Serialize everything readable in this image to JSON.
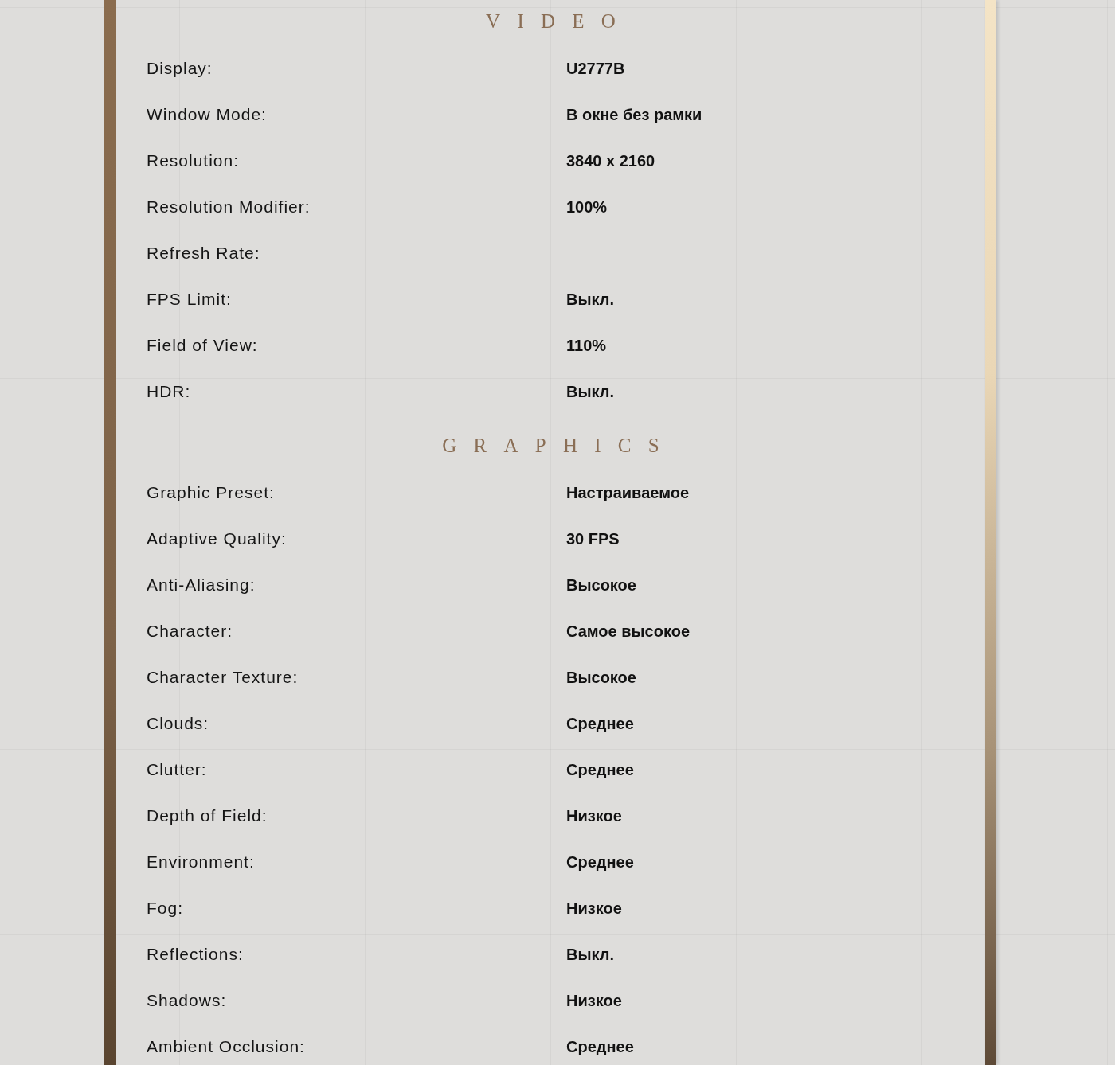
{
  "sections": [
    {
      "title": "VIDEO",
      "settings": [
        {
          "label": "Display:",
          "value": "U2777B"
        },
        {
          "label": "Window Mode:",
          "value": "В окне без рамки"
        },
        {
          "label": "Resolution:",
          "value": "3840 x 2160"
        },
        {
          "label": "Resolution Modifier:",
          "value": "100%"
        },
        {
          "label": "Refresh Rate:"
        },
        {
          "label": "FPS Limit:",
          "value": "Выкл."
        },
        {
          "label": "Field of View:",
          "value": "110%"
        },
        {
          "label": "HDR:",
          "value": "Выкл."
        }
      ]
    },
    {
      "title": "GRAPHICS",
      "settings": [
        {
          "label": "Graphic Preset:",
          "value": "Настраиваемое"
        },
        {
          "label": "Adaptive Quality:",
          "value": "30 FPS"
        },
        {
          "label": "Anti-Aliasing:",
          "value": "Высокое"
        },
        {
          "label": "Character:",
          "value": "Самое высокое"
        },
        {
          "label": "Character Texture:",
          "value": "Высокое"
        },
        {
          "label": "Clouds:",
          "value": "Среднее"
        },
        {
          "label": "Clutter:",
          "value": "Среднее"
        },
        {
          "label": "Depth of Field:",
          "value": "Низкое"
        },
        {
          "label": "Environment:",
          "value": "Среднее"
        },
        {
          "label": "Fog:",
          "value": "Низкое"
        },
        {
          "label": "Reflections:",
          "value": "Выкл."
        },
        {
          "label": "Shadows:",
          "value": "Низкое"
        },
        {
          "label": "Ambient Occlusion:",
          "value": "Среднее"
        }
      ]
    }
  ]
}
